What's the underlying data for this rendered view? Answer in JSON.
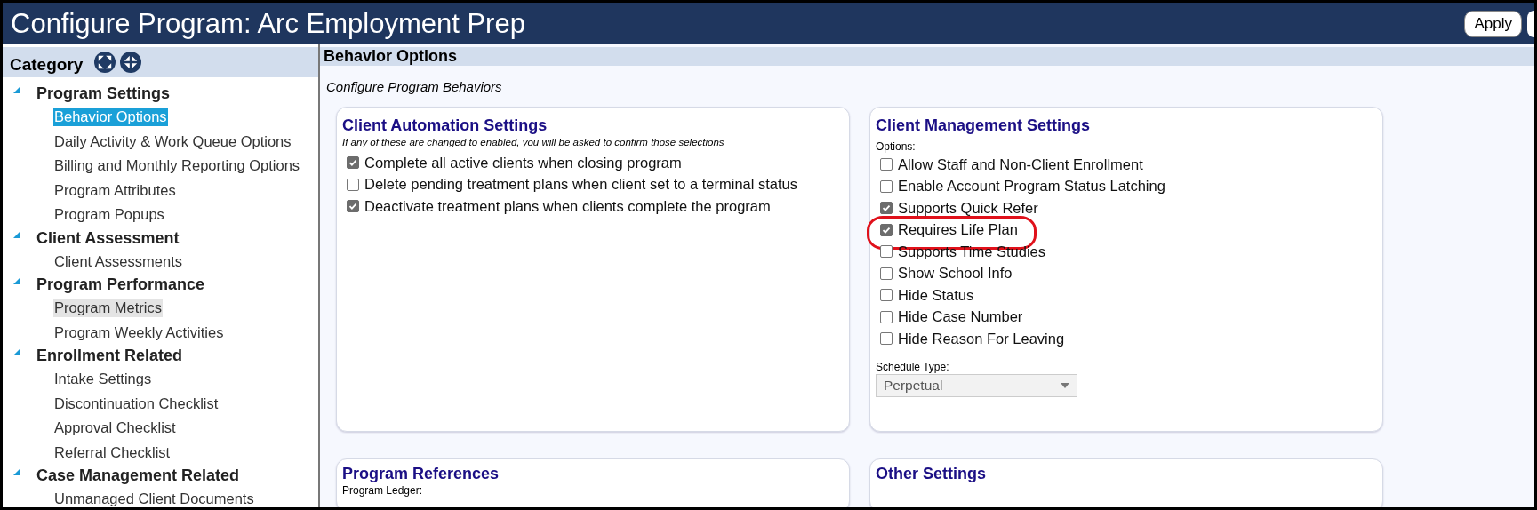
{
  "window": {
    "title": "Configure Program: Arc Employment Prep",
    "buttons": [
      "Apply"
    ]
  },
  "sidebar": {
    "title": "Category",
    "groups": [
      {
        "label": "Program Settings",
        "expanded": true,
        "children": [
          {
            "label": "Behavior Options",
            "selected": true,
            "hovered": false
          },
          {
            "label": "Daily Activity & Work Queue Options",
            "selected": false,
            "hovered": false
          },
          {
            "label": "Billing and Monthly Reporting Options",
            "selected": false,
            "hovered": false
          },
          {
            "label": "Program Attributes",
            "selected": false,
            "hovered": false
          },
          {
            "label": "Program Popups",
            "selected": false,
            "hovered": false
          }
        ]
      },
      {
        "label": "Client Assessment",
        "expanded": true,
        "children": [
          {
            "label": "Client Assessments",
            "selected": false,
            "hovered": false
          }
        ]
      },
      {
        "label": "Program Performance",
        "expanded": true,
        "children": [
          {
            "label": "Program Metrics",
            "selected": false,
            "hovered": true
          },
          {
            "label": "Program Weekly Activities",
            "selected": false,
            "hovered": false
          }
        ]
      },
      {
        "label": "Enrollment Related",
        "expanded": true,
        "children": [
          {
            "label": "Intake Settings",
            "selected": false,
            "hovered": false
          },
          {
            "label": "Discontinuation Checklist",
            "selected": false,
            "hovered": false
          },
          {
            "label": "Approval Checklist",
            "selected": false,
            "hovered": false
          },
          {
            "label": "Referral Checklist",
            "selected": false,
            "hovered": false
          }
        ]
      },
      {
        "label": "Case Management Related",
        "expanded": true,
        "children": [
          {
            "label": "Unmanaged Client Documents",
            "selected": false,
            "hovered": false
          }
        ]
      }
    ]
  },
  "content": {
    "title": "Behavior Options",
    "subtitle": "Configure Program Behaviors",
    "cards": [
      {
        "title": "Client Automation Settings",
        "note": "If any of these are changed to enabled, you will be asked to confirm those selections",
        "options": [
          {
            "label": "Complete all active clients when closing program",
            "checked": true,
            "highlighted": false
          },
          {
            "label": "Delete pending treatment plans when client set to a terminal status",
            "checked": false,
            "highlighted": false
          },
          {
            "label": "Deactivate treatment plans when clients complete the program",
            "checked": true,
            "highlighted": false
          }
        ]
      },
      {
        "title": "Client Management Settings",
        "options_label": "Options:",
        "options": [
          {
            "label": "Allow Staff and Non-Client Enrollment",
            "checked": false,
            "highlighted": false
          },
          {
            "label": "Enable Account Program Status Latching",
            "checked": false,
            "highlighted": false
          },
          {
            "label": "Supports Quick Refer",
            "checked": true,
            "highlighted": false
          },
          {
            "label": "Requires Life Plan",
            "checked": true,
            "highlighted": true
          },
          {
            "label": "Supports Time Studies",
            "checked": false,
            "highlighted": false
          },
          {
            "label": "Show School Info",
            "checked": false,
            "highlighted": false
          },
          {
            "label": "Hide Status",
            "checked": false,
            "highlighted": false
          },
          {
            "label": "Hide Case Number",
            "checked": false,
            "highlighted": false
          },
          {
            "label": "Hide Reason For Leaving",
            "checked": false,
            "highlighted": false
          }
        ],
        "select_label": "Schedule Type:",
        "select_value": "Perpetual"
      },
      {
        "title": "Program References",
        "field_label": "Program Ledger:"
      },
      {
        "title": "Other Settings"
      }
    ]
  }
}
